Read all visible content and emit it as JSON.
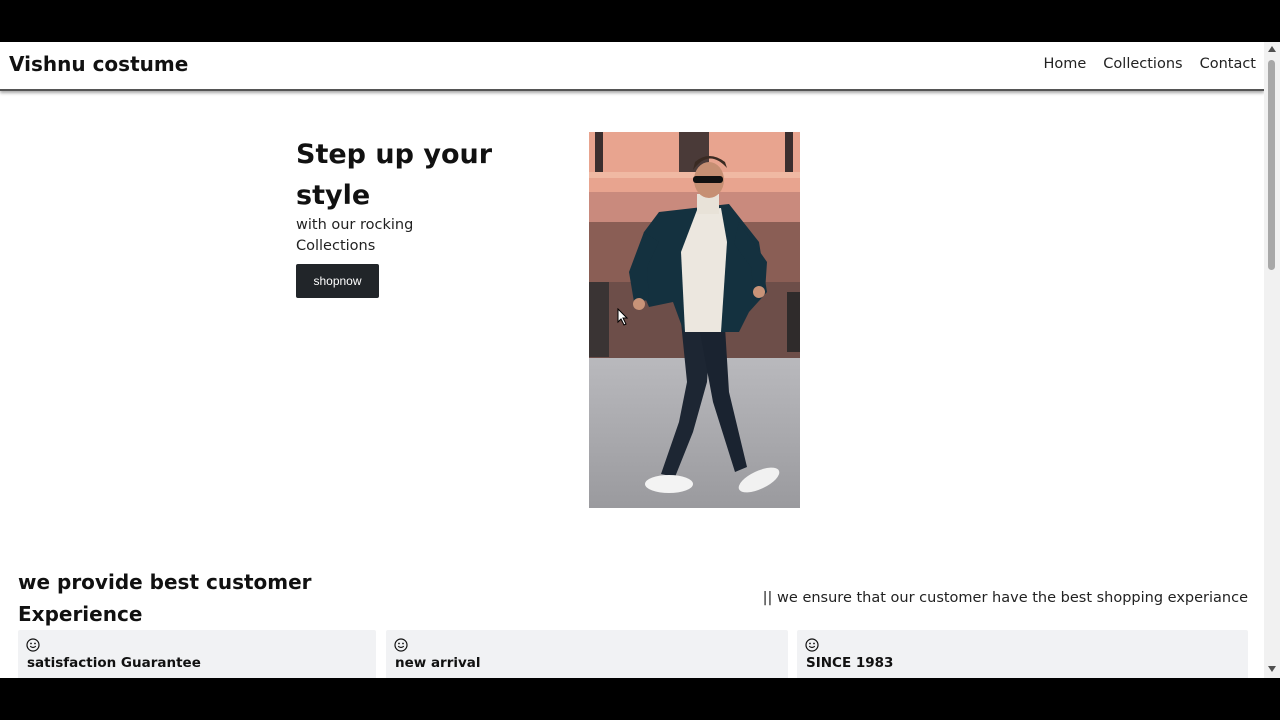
{
  "navbar": {
    "brand": "Vishnu costume",
    "links": [
      "Home",
      "Collections",
      "Contact"
    ]
  },
  "hero": {
    "title": "Step up your style",
    "subtitle": "with our rocking Collections",
    "button_label": "shopnow",
    "image_icon": "fashion-model-photo"
  },
  "experience": {
    "title": "we provide best customer Experience",
    "note": "|| we ensure that our customer have the best shopping experiance",
    "cards": [
      {
        "icon": "smile-icon",
        "title": "satisfaction Guarantee"
      },
      {
        "icon": "smile-icon",
        "title": "new arrival"
      },
      {
        "icon": "smile-icon",
        "title": "SINCE 1983"
      }
    ]
  },
  "colors": {
    "button_bg": "#212529",
    "card_bg": "#f1f2f4",
    "text": "#111111"
  }
}
